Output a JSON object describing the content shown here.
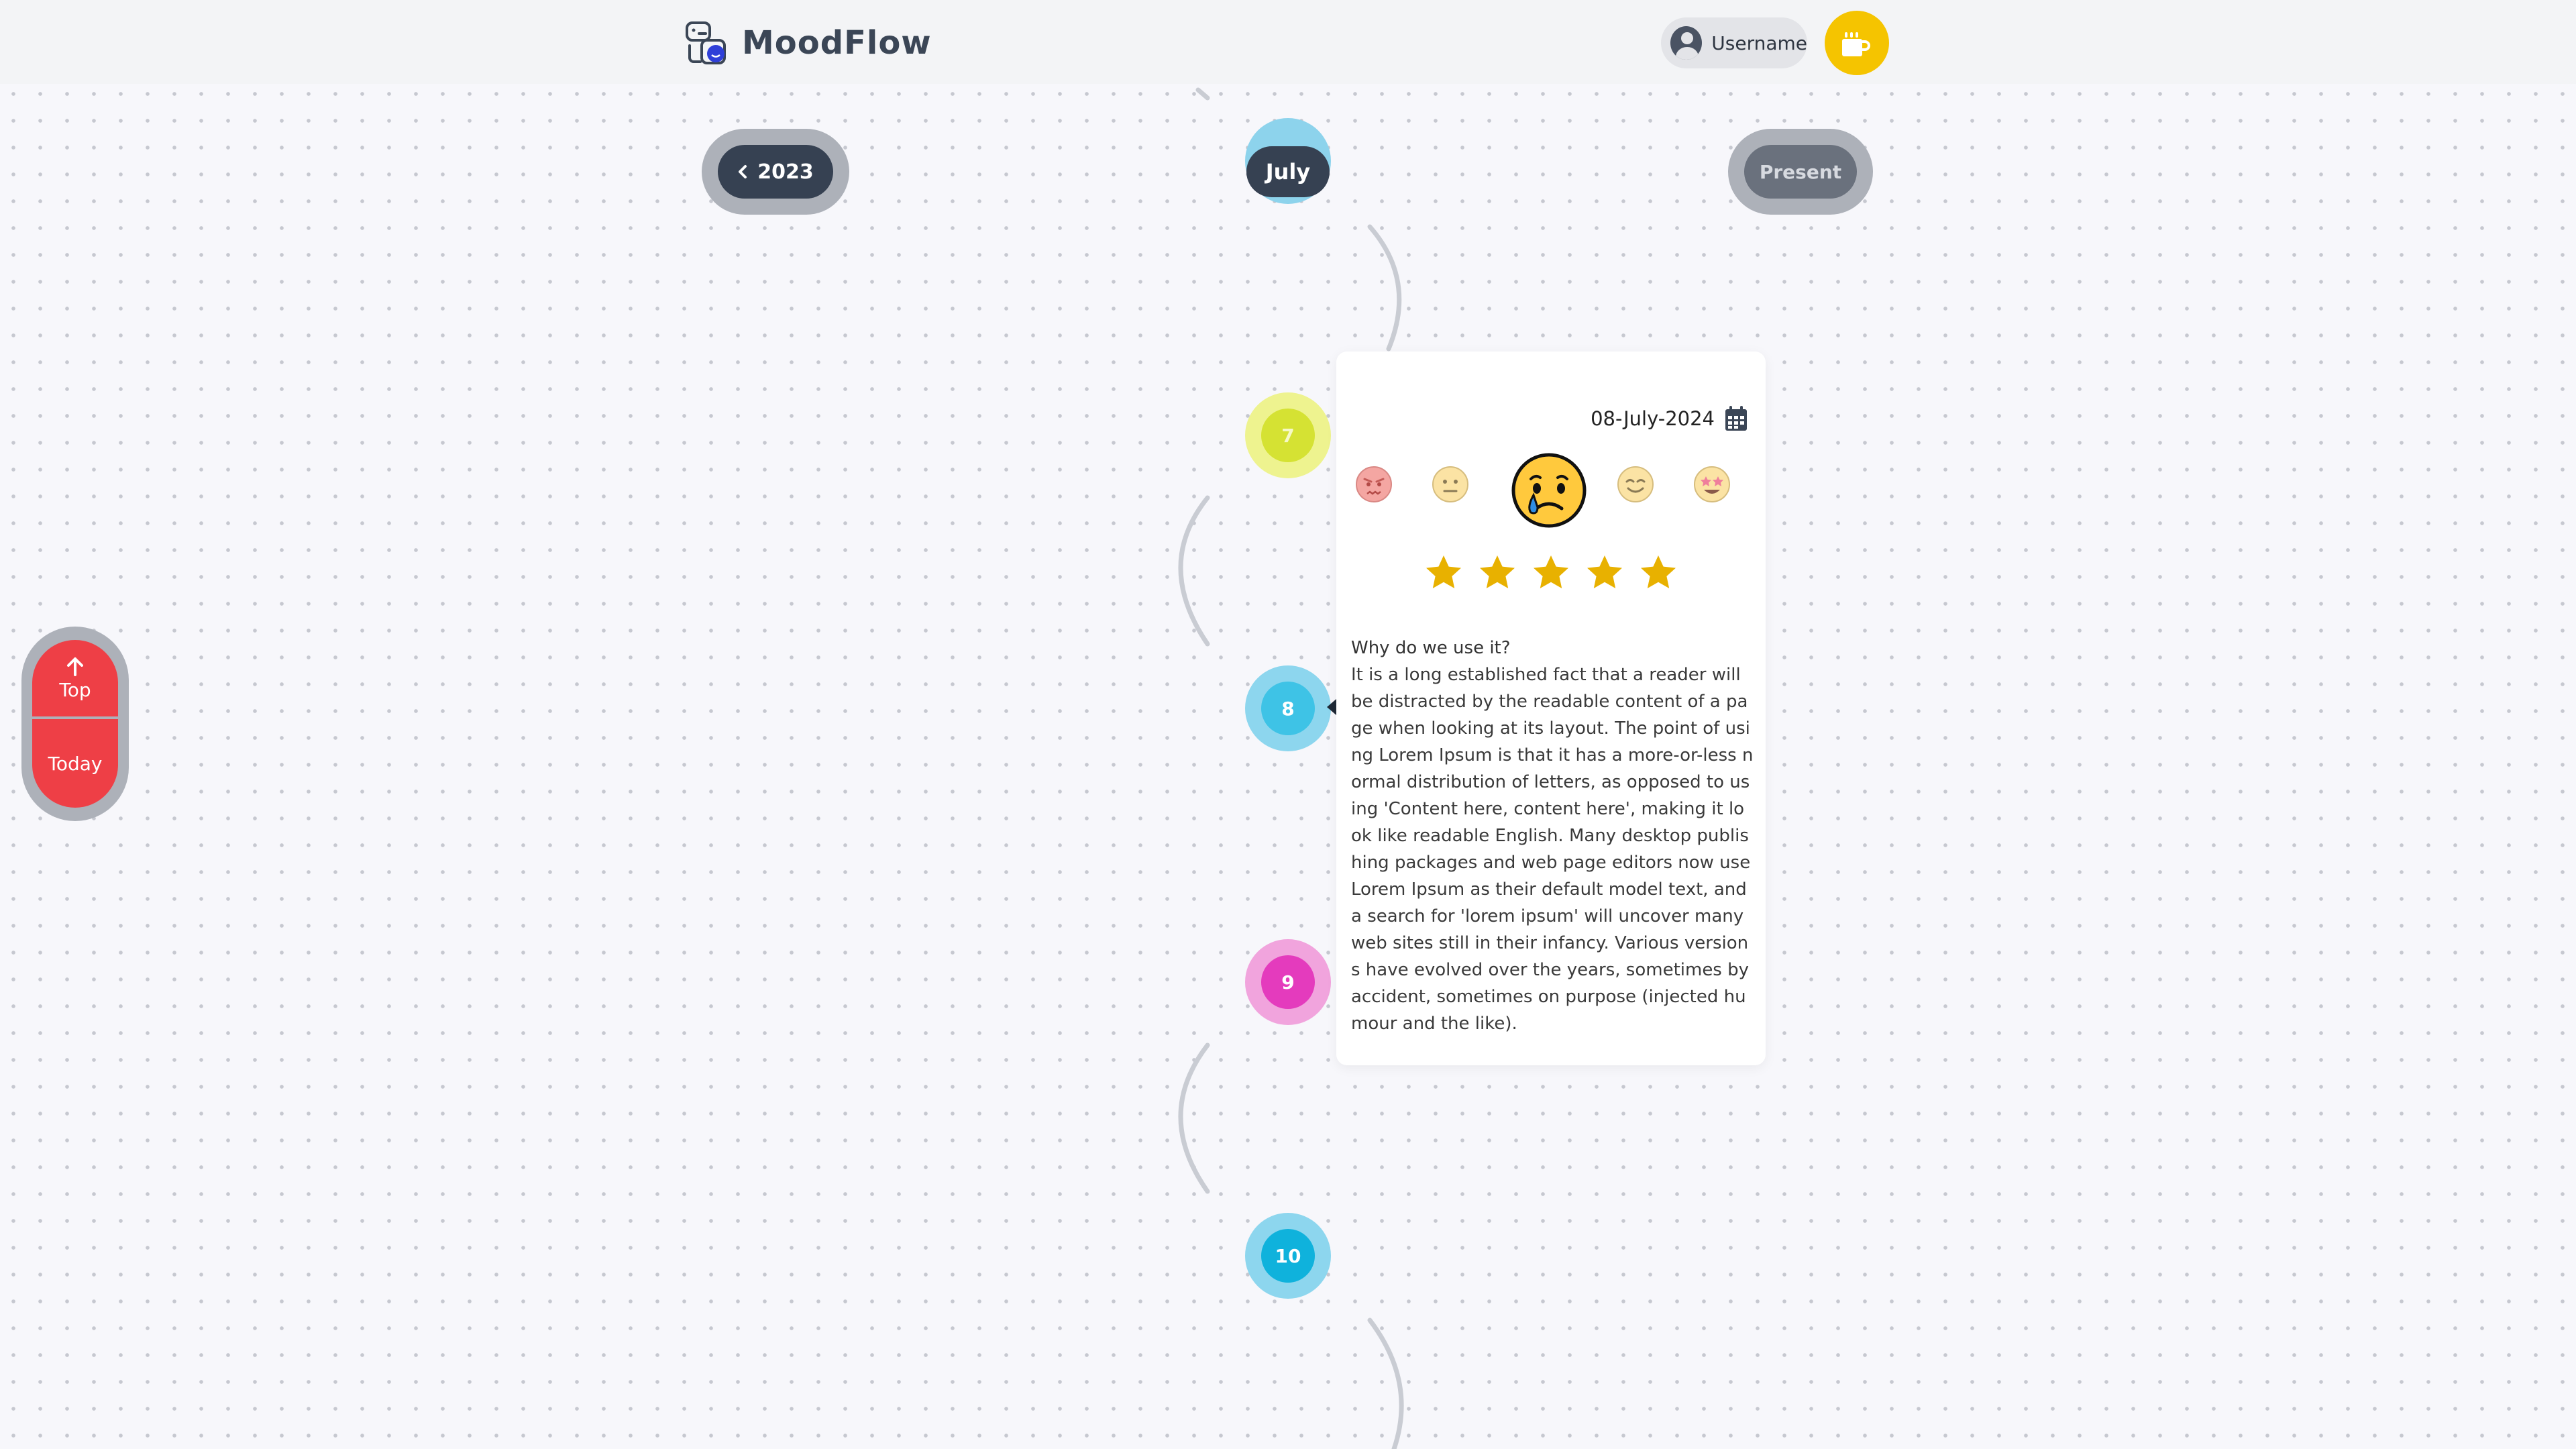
{
  "header": {
    "app_name": "MoodFlow",
    "username": "Username",
    "coffee_icon": "coffee-cup-icon"
  },
  "nav": {
    "year_label": "2023",
    "month_label": "July",
    "present_label": "Present"
  },
  "timeline": {
    "days": [
      "7",
      "8",
      "9",
      "10"
    ],
    "day_colors": {
      "7": "#d5e233",
      "8": "#3ec3e6",
      "9": "#e43bbd",
      "10": "#0fb2dc"
    }
  },
  "entry": {
    "date": "08-July-2024",
    "moods": [
      "angry",
      "neutral",
      "crying",
      "smiling",
      "star-struck"
    ],
    "selected_mood": "crying",
    "rating": 5,
    "rating_max": 5,
    "title": "Why do we use it?",
    "body": "It is a long established fact that a reader will be distracted by the readable content of a page when looking at its layout. The point of using Lorem Ipsum is that it has a more-or-less normal distribution of letters, as opposed to using 'Content here, content here', making it look like readable English. Many desktop publishing packages and web page editors now use Lorem Ipsum as their default model text, and a search for 'lorem ipsum' will uncover many web sites still in their infancy. Various versions have evolved over the years, sometimes by accident, sometimes on purpose (injected humour and the like)."
  },
  "side_nav": {
    "top_label": "Top",
    "today_label": "Today"
  },
  "colors": {
    "accent_red": "#ee3f46",
    "star_gold": "#e8b100",
    "dark_pill": "#364152",
    "coffee_yellow": "#f5c400"
  }
}
